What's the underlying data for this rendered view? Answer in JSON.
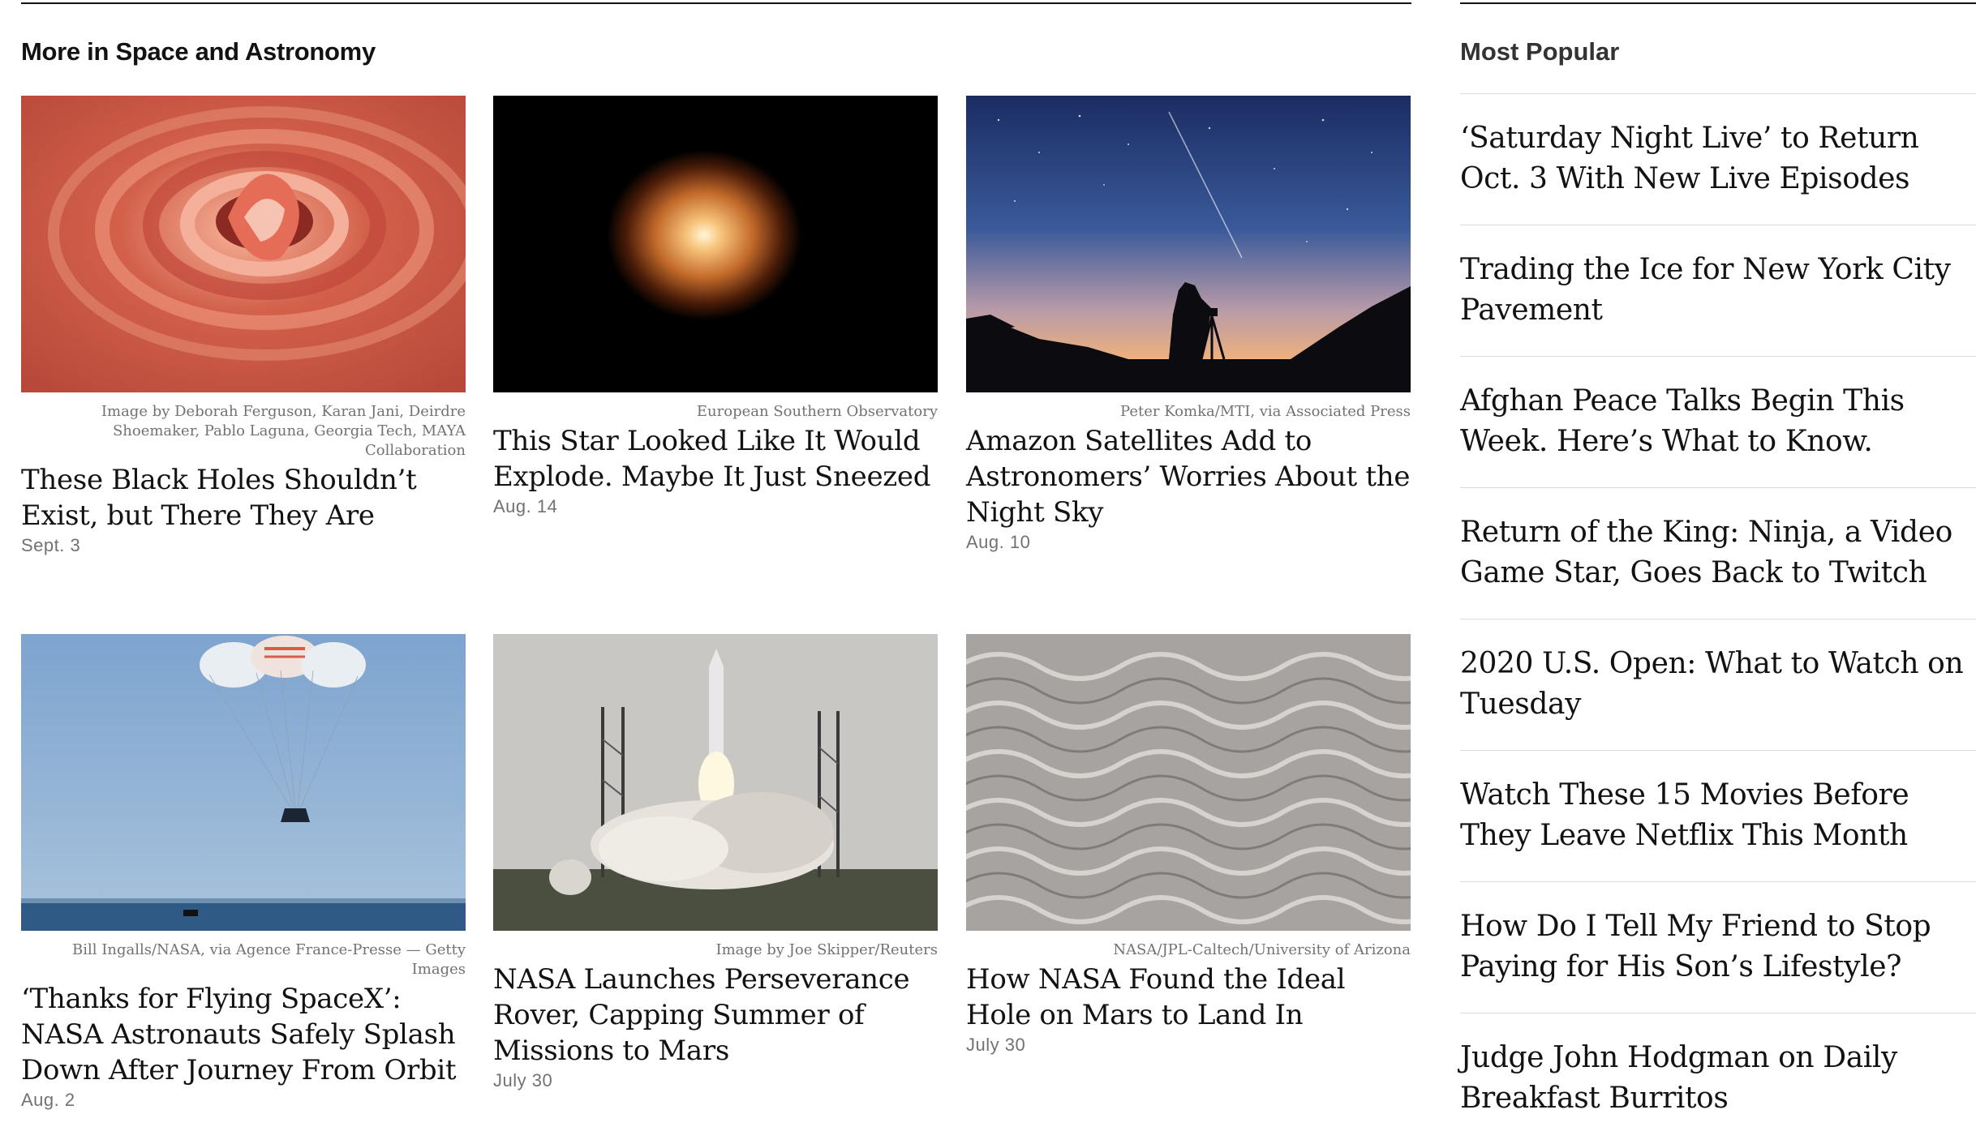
{
  "section": {
    "title": "More in Space and Astronomy",
    "articles": [
      {
        "credit": "Image by Deborah Ferguson, Karan Jani, Deirdre Shoemaker, Pablo Laguna, Georgia Tech, MAYA Collaboration",
        "headline": "These Black Holes Shouldn’t Exist, but There They Are",
        "date": "Sept. 3",
        "image": "black-hole-merger-image"
      },
      {
        "credit": "European Southern Observatory",
        "headline": "This Star Looked Like It Would Explode. Maybe It Just Sneezed",
        "date": "Aug. 14",
        "image": "betelgeuse-star-image"
      },
      {
        "credit": "Peter Komka/MTI, via Associated Press",
        "headline": "Amazon Satellites Add to Astronomers’ Worries About the Night Sky",
        "date": "Aug. 10",
        "image": "night-sky-photographer-image"
      },
      {
        "credit": "Bill Ingalls/NASA, via Agence France-Presse — Getty Images",
        "headline": "‘Thanks for Flying SpaceX’: NASA Astronauts Safely Splash Down After Journey From Orbit",
        "date": "Aug. 2",
        "image": "capsule-parachutes-image"
      },
      {
        "credit": "Image by Joe Skipper/Reuters",
        "headline": "NASA Launches Perseverance Rover, Capping Summer of Missions to Mars",
        "date": "July 30",
        "image": "rocket-launch-image"
      },
      {
        "credit": "NASA/JPL-Caltech/University of Arizona",
        "headline": "How NASA Found the Ideal Hole on Mars to Land In",
        "date": "July 30",
        "image": "mars-surface-image"
      }
    ]
  },
  "most_popular": {
    "title": "Most Popular",
    "items": [
      "‘Saturday Night Live’ to Return Oct. 3 With New Live Episodes",
      "Trading the Ice for New York City Pavement",
      "Afghan Peace Talks Begin This Week. Here’s What to Know.",
      "Return of the King: Ninja, a Video Game Star, Goes Back to Twitch",
      "2020 U.S. Open: What to Watch on Tuesday",
      "Watch These 15 Movies Before They Leave Netflix This Month",
      "How Do I Tell My Friend to Stop Paying for His Son’s Lifestyle?",
      "Judge John Hodgman on Daily Breakfast Burritos"
    ]
  }
}
